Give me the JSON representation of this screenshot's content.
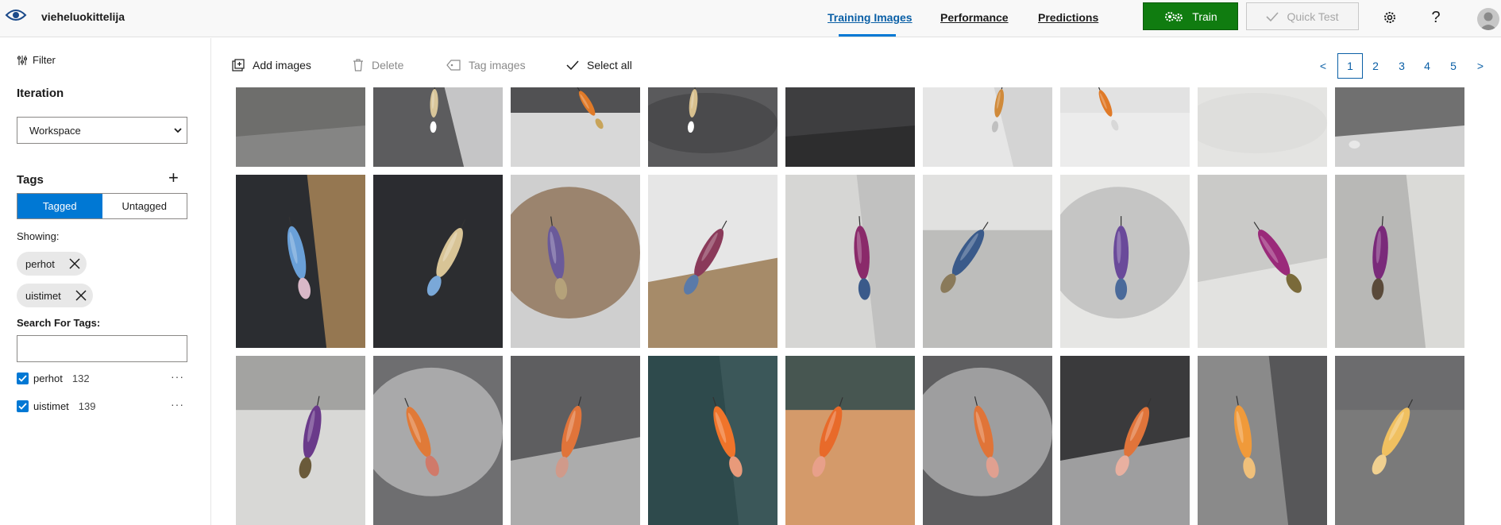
{
  "app": {
    "project_name": "vieheluokittelija"
  },
  "nav": {
    "tabs": [
      {
        "label": "Training Images",
        "active": true
      },
      {
        "label": "Performance",
        "active": false
      },
      {
        "label": "Predictions",
        "active": false
      }
    ],
    "train_label": "Train",
    "quick_test_label": "Quick Test",
    "help_label": "?"
  },
  "sidebar": {
    "filter_label": "Filter",
    "iteration_heading": "Iteration",
    "iteration_value": "Workspace",
    "tags_heading": "Tags",
    "add_tag": "+",
    "segment": {
      "tagged": "Tagged",
      "untagged": "Untagged",
      "selected": "Tagged"
    },
    "showing_label": "Showing:",
    "chips": [
      "perhot",
      "uistimet"
    ],
    "search_label": "Search For Tags:",
    "search_value": "",
    "tag_list": [
      {
        "name": "perhot",
        "count": "132",
        "checked": true
      },
      {
        "name": "uistimet",
        "count": "139",
        "checked": true
      }
    ],
    "more_label": "···"
  },
  "toolbar": {
    "add_images": "Add images",
    "delete": "Delete",
    "tag_images": "Tag images",
    "select_all": "Select all"
  },
  "pager": {
    "prev": "<",
    "pages": [
      "1",
      "2",
      "3",
      "4",
      "5"
    ],
    "current": "1",
    "next": ">"
  },
  "colors": {
    "accent": "#0078d4",
    "link": "#0a5fa6",
    "train_green": "#107c10"
  },
  "gallery": {
    "rows": [
      [
        {
          "bg": "#6e6e6c",
          "bg2": "#8a8a88",
          "lure": null,
          "lure2": null
        },
        {
          "bg": "#5c5c5e",
          "bg2": "#e0e0e0",
          "lure": "#d9c69a",
          "lure2": "#ffffff"
        },
        {
          "bg": "#d8d8d8",
          "bg2": "#3a3a3c",
          "lure": "#e07a28",
          "lure2": "#c8a45a"
        },
        {
          "bg": "#5a5a5c",
          "bg2": "#454547",
          "lure": "#d8c08e",
          "lure2": "#ffffff"
        },
        {
          "bg": "#3e3e40",
          "bg2": "#2a2a2c",
          "lure": null,
          "lure2": null
        },
        {
          "bg": "#e6e6e6",
          "bg2": "#d0d0d0",
          "lure": "#d08a3a",
          "lure2": "#c0c0c0"
        },
        {
          "bg": "#ececec",
          "bg2": "#e0e0e0",
          "lure": "#e07a28",
          "lure2": "#d8d8d8"
        },
        {
          "bg": "#e4e4e2",
          "bg2": "#dcdcda",
          "lure": null,
          "lure2": null
        },
        {
          "bg": "#707070",
          "bg2": "#e0e0e0",
          "lure": null,
          "lure2": "#e8e8e8"
        }
      ],
      [
        {
          "bg": "#2b2d31",
          "bg2": "#b08a5a",
          "lure": "#6aa0d8",
          "lure2": "#d9b8c8"
        },
        {
          "bg": "#2c2d30",
          "bg2": "#2c2d30",
          "lure": "#d8c496",
          "lure2": "#7aa8d8"
        },
        {
          "bg": "#cfcfcf",
          "bg2": "#8a6b4e",
          "lure": "#6a5a9a",
          "lure2": "#b5a27a"
        },
        {
          "bg": "#e6e6e6",
          "bg2": "#9a7a52",
          "lure": "#8a3a5a",
          "lure2": "#5a7aa8"
        },
        {
          "bg": "#d6d6d4",
          "bg2": "#bcbcba",
          "lure": "#8a2a6a",
          "lure2": "#3a5a8a"
        },
        {
          "bg": "#bdbdbb",
          "bg2": "#e8e8e6",
          "lure": "#3a5a8a",
          "lure2": "#8a7a5a"
        },
        {
          "bg": "#e6e6e4",
          "bg2": "#bababa",
          "lure": "#6a4a9a",
          "lure2": "#4a6a9a"
        },
        {
          "bg": "#cacac8",
          "bg2": "#e6e6e4",
          "lure": "#9a2a7a",
          "lure2": "#7a6a3a"
        },
        {
          "bg": "#b8b8b6",
          "bg2": "#e2e2e0",
          "lure": "#7a2a7a",
          "lure2": "#5a4a3a"
        }
      ],
      [
        {
          "bg": "#d8d8d6",
          "bg2": "#9a9a98",
          "lure": "#6a3a8a",
          "lure2": "#6a5a3a"
        },
        {
          "bg": "#6e6e70",
          "bg2": "#bdbdbd",
          "lure": "#e07a38",
          "lure2": "#d07a6a"
        },
        {
          "bg": "#5e5e60",
          "bg2": "#bababa",
          "lure": "#e0743a",
          "lure2": "#d09a8a"
        },
        {
          "bg": "#2e4a4c",
          "bg2": "#3e5a5c",
          "lure": "#f0742a",
          "lure2": "#e89a7a"
        },
        {
          "bg": "#d49a6a",
          "bg2": "#2e4a4c",
          "lure": "#e86a2a",
          "lure2": "#e8a08a"
        },
        {
          "bg": "#5e5e60",
          "bg2": "#b4b4b4",
          "lure": "#e07438",
          "lure2": "#e0a090"
        },
        {
          "bg": "#3a3a3c",
          "bg2": "#b0b0b0",
          "lure": "#e0743a",
          "lure2": "#e8b0a0"
        },
        {
          "bg": "#8a8a8a",
          "bg2": "#4a4a4c",
          "lure": "#f09a3a",
          "lure2": "#f0c07a"
        },
        {
          "bg": "#7a7a7a",
          "bg2": "#6a6a6c",
          "lure": "#f0c060",
          "lure2": "#f0d090"
        }
      ]
    ]
  }
}
